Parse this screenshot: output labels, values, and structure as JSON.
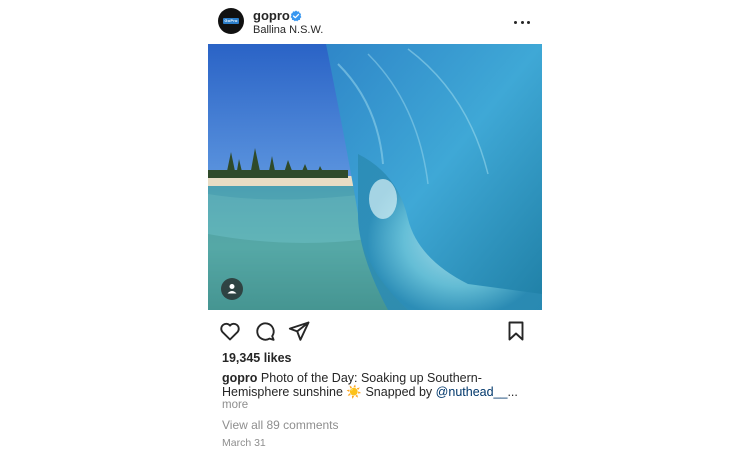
{
  "post": {
    "username": "gopro",
    "avatar_text": "GoPro",
    "location": "Ballina N.S.W.",
    "likes": "19,345 likes",
    "caption": {
      "user": "gopro",
      "text": "Photo of the Day: Soaking up Southern-Hemisphere sunshine",
      "emoji": "☀️",
      "snapped_by": "Snapped by",
      "mention": "@nuthead__",
      "ellipsis": "...",
      "more": "more"
    },
    "view_comments": "View all 89 comments",
    "date": "March 31"
  },
  "icons": {
    "verified": "verified-badge-icon",
    "more": "more-options-icon",
    "like": "heart-icon",
    "comment": "comment-icon",
    "share": "share-icon",
    "save": "bookmark-icon",
    "tag": "user-tag-icon"
  },
  "colors": {
    "verified": "#3897f0",
    "mention": "#00376b",
    "muted": "#8e8e8e"
  }
}
